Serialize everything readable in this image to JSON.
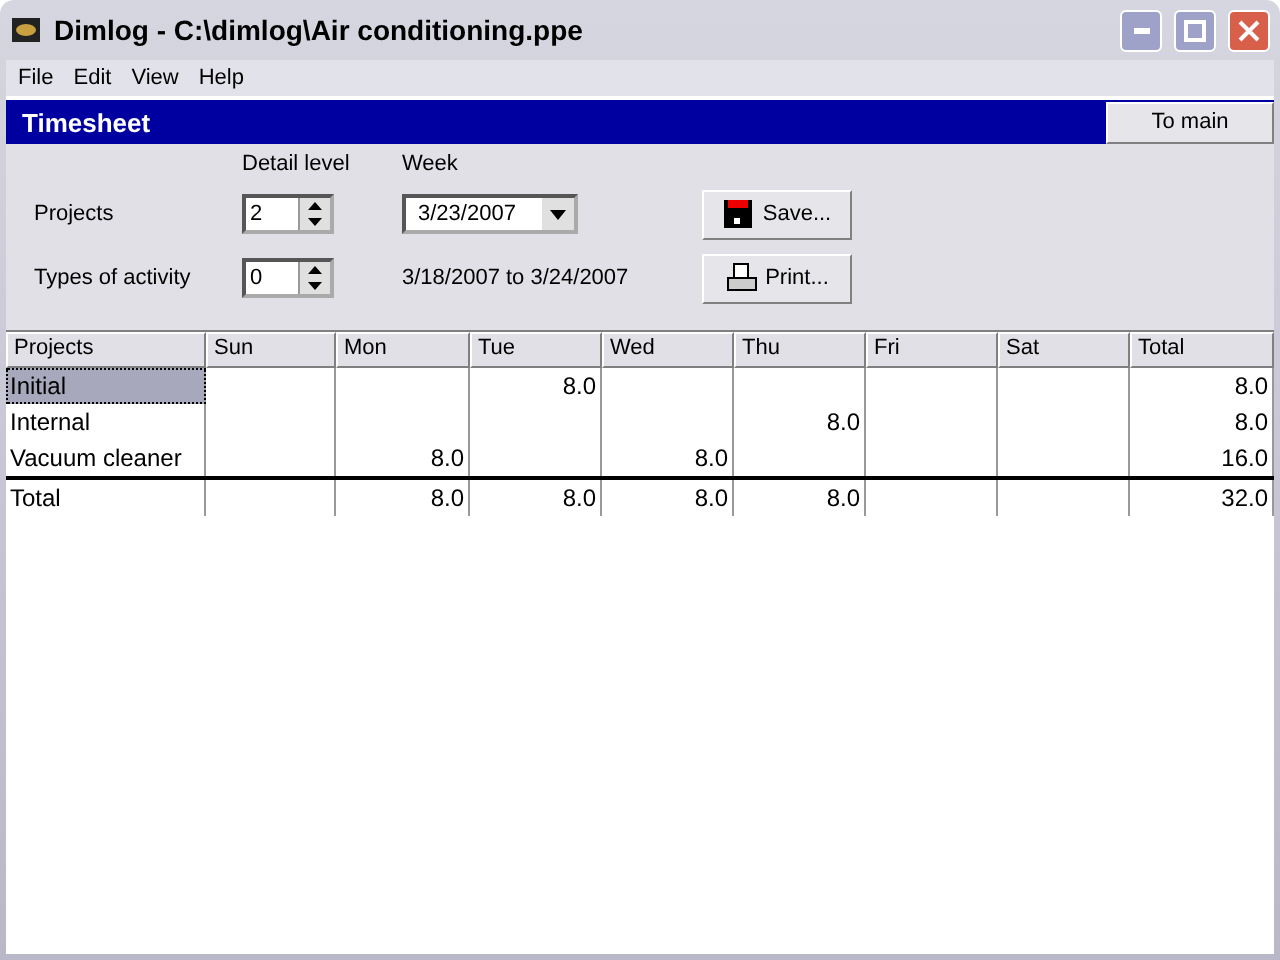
{
  "window": {
    "title": "Dimlog - C:\\dimlog\\Air conditioning.ppe"
  },
  "menu": [
    "File",
    "Edit",
    "View",
    "Help"
  ],
  "header": {
    "title": "Timesheet",
    "button": "To main"
  },
  "form": {
    "detail_label": "Detail level",
    "week_label": "Week",
    "projects_label": "Projects",
    "projects_value": "2",
    "activity_label": "Types of activity",
    "activity_value": "0",
    "week_value": "3/23/2007",
    "range": "3/18/2007 to 3/24/2007",
    "save": "Save...",
    "print": "Print..."
  },
  "table": {
    "columns": [
      "Projects",
      "Sun",
      "Mon",
      "Tue",
      "Wed",
      "Thu",
      "Fri",
      "Sat",
      "Total"
    ],
    "rows": [
      {
        "selected": true,
        "project": "Initial",
        "tue": "8.0",
        "total": "8.0"
      },
      {
        "selected": false,
        "project": "Internal",
        "thu": "8.0",
        "total": "8.0"
      },
      {
        "selected": false,
        "project": "Vacuum cleaner",
        "mon": "8.0",
        "wed": "8.0",
        "total": "16.0"
      }
    ],
    "total_row": {
      "project": "Total",
      "mon": "8.0",
      "tue": "8.0",
      "wed": "8.0",
      "thu": "8.0",
      "total": "32.0"
    }
  }
}
